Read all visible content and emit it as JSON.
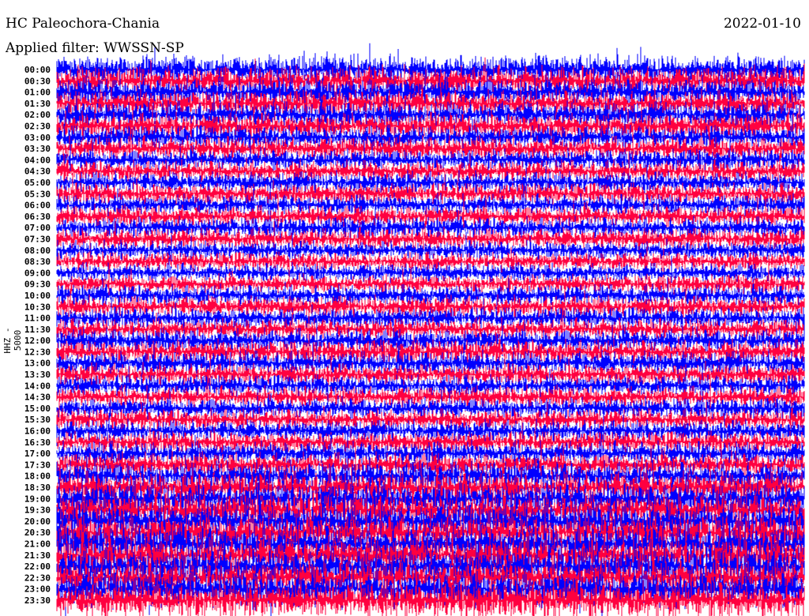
{
  "header": {
    "station": "HC Paleochora-Chania",
    "filter": "Applied filter: WWSSN-SP",
    "date": "2022-01-10"
  },
  "chart_data": {
    "type": "line",
    "title": "HC Paleochora-Chania",
    "ylabel": "HHZ - 5000",
    "row_labels": [
      "00:00",
      "00:30",
      "01:00",
      "01:30",
      "02:00",
      "02:30",
      "03:00",
      "03:30",
      "04:00",
      "04:30",
      "05:00",
      "05:30",
      "06:00",
      "06:30",
      "07:00",
      "07:30",
      "08:00",
      "08:30",
      "09:00",
      "09:30",
      "10:00",
      "10:30",
      "11:00",
      "11:30",
      "12:00",
      "12:30",
      "13:00",
      "13:30",
      "14:00",
      "14:30",
      "15:00",
      "15:30",
      "16:00",
      "16:30",
      "17:00",
      "17:30",
      "18:00",
      "18:30",
      "19:00",
      "19:30",
      "20:00",
      "20:30",
      "21:00",
      "21:30",
      "22:00",
      "22:30",
      "23:00",
      "23:30"
    ],
    "row_colors": [
      "#0000ff",
      "#ff0040"
    ],
    "relative_amplitude": [
      1.1,
      1.1,
      1.1,
      1.0,
      1.0,
      1.0,
      0.9,
      0.9,
      0.8,
      0.8,
      0.8,
      0.8,
      0.8,
      0.8,
      0.8,
      0.8,
      0.7,
      0.7,
      0.7,
      0.7,
      0.8,
      0.8,
      0.8,
      0.8,
      0.9,
      0.9,
      0.9,
      0.8,
      0.8,
      0.8,
      0.8,
      0.8,
      0.8,
      0.8,
      0.9,
      0.9,
      1.1,
      1.2,
      1.3,
      1.3,
      1.4,
      1.4,
      1.4,
      1.4,
      1.4,
      1.4,
      1.4,
      1.4
    ],
    "minutes_per_row": 30
  }
}
